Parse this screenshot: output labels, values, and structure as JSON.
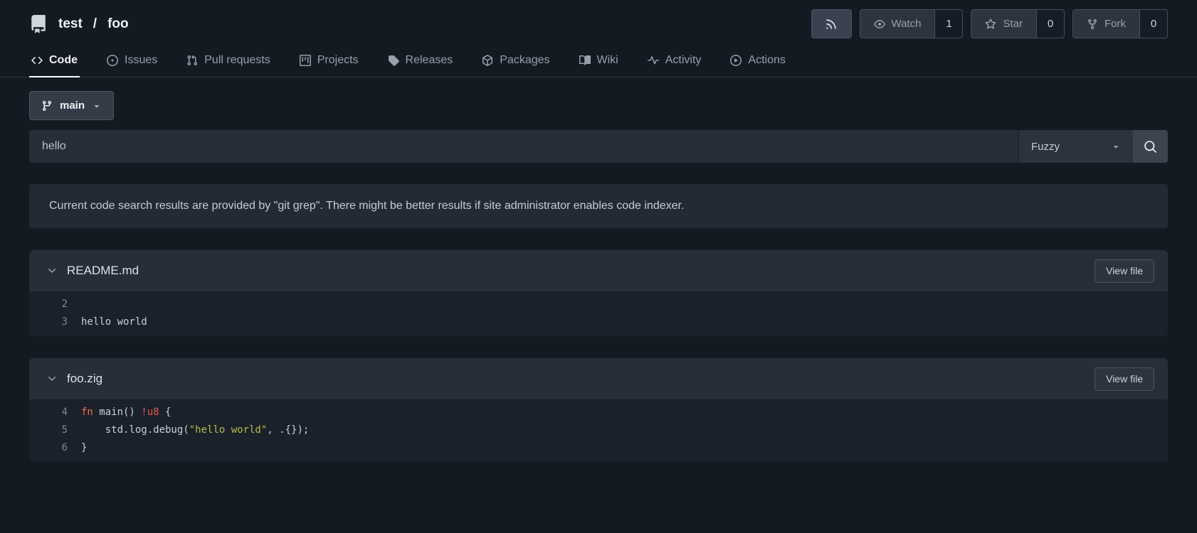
{
  "repo": {
    "icon": "repo-book-icon",
    "owner": "test",
    "separator": "/",
    "name": "foo"
  },
  "actions": {
    "rss": {
      "icon": "rss-icon"
    },
    "watch": {
      "icon": "eye-icon",
      "label": "Watch",
      "count": "1"
    },
    "star": {
      "icon": "star-icon",
      "label": "Star",
      "count": "0"
    },
    "fork": {
      "icon": "fork-icon",
      "label": "Fork",
      "count": "0"
    }
  },
  "tabs": [
    {
      "label": "Code",
      "icon": "code-icon",
      "active": true
    },
    {
      "label": "Issues",
      "icon": "issue-opened-icon",
      "active": false
    },
    {
      "label": "Pull requests",
      "icon": "pull-request-icon",
      "active": false
    },
    {
      "label": "Projects",
      "icon": "project-board-icon",
      "active": false
    },
    {
      "label": "Releases",
      "icon": "tag-icon",
      "active": false
    },
    {
      "label": "Packages",
      "icon": "package-icon",
      "active": false
    },
    {
      "label": "Wiki",
      "icon": "book-icon",
      "active": false
    },
    {
      "label": "Activity",
      "icon": "pulse-icon",
      "active": false
    },
    {
      "label": "Actions",
      "icon": "play-circle-icon",
      "active": false
    }
  ],
  "branch": {
    "icon": "git-branch-icon",
    "label": "main",
    "caret": "triangle-down-icon"
  },
  "search": {
    "value": "hello",
    "mode": "Fuzzy",
    "button_icon": "search-icon"
  },
  "notice": {
    "text": "Current code search results are provided by \"git grep\". There might be better results if site administrator enables code indexer."
  },
  "results": [
    {
      "filename": "README.md",
      "view_button": "View file",
      "lines": [
        {
          "number": "2",
          "text": ""
        },
        {
          "number": "3",
          "text": "hello world"
        }
      ]
    },
    {
      "filename": "foo.zig",
      "view_button": "View file",
      "lines": [
        {
          "number": "4",
          "seg_keyword": "fn",
          "seg_plain1": " main() ",
          "seg_type": "!u8",
          "seg_plain2": " {"
        },
        {
          "number": "5",
          "seg_plain1": "    std.log.debug(",
          "seg_string": "\"hello world\"",
          "seg_plain2": ", .{});"
        },
        {
          "number": "6",
          "seg_plain1": "}"
        }
      ]
    }
  ],
  "colors": {
    "background": "#141a22",
    "panel": "#272e38",
    "code_background": "#1b212b",
    "active_tab_underline": "#ffffff",
    "syntax_keyword": "#ef6e4e",
    "syntax_type": "#e25a50",
    "syntax_string": "#b6bb49"
  }
}
